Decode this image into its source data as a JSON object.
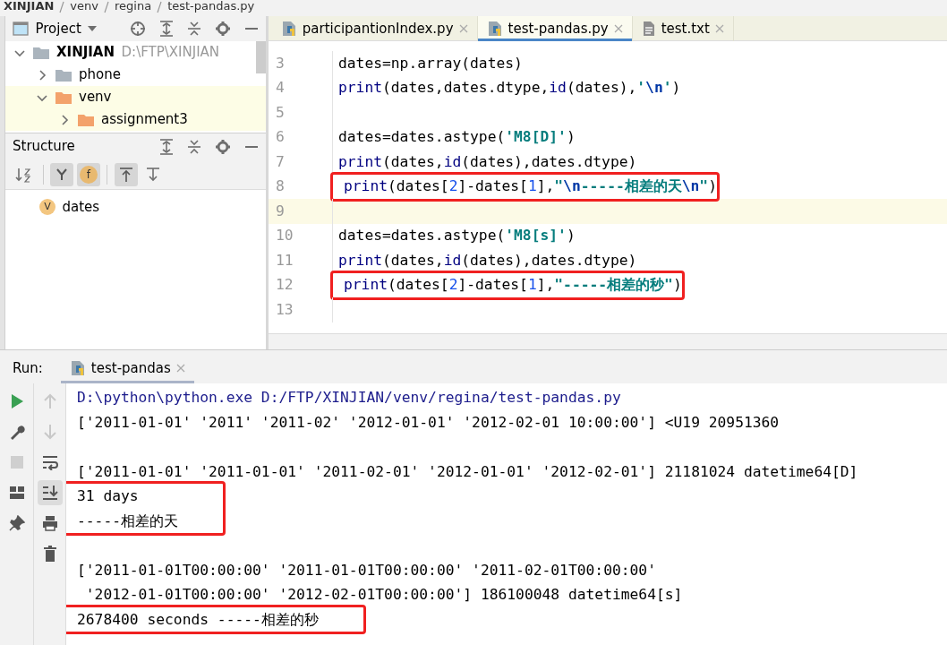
{
  "breadcrumb": [
    "XINJIAN",
    "venv",
    "regina",
    "test-pandas.py"
  ],
  "project_panel": {
    "title": "Project",
    "tree": [
      {
        "label": "XINJIAN",
        "path": "D:\\FTP\\XINJIAN",
        "expanded": true,
        "excluded": false,
        "children": [
          {
            "label": "phone",
            "expanded": false,
            "excluded": false
          },
          {
            "label": "venv",
            "expanded": true,
            "excluded": true,
            "children": [
              {
                "label": "assignment3",
                "expanded": false,
                "excluded": true
              }
            ]
          }
        ]
      }
    ]
  },
  "structure_panel": {
    "title": "Structure",
    "toggles": [
      {
        "on": false
      },
      {
        "on": true
      },
      {
        "label": "f",
        "on": true
      },
      {
        "on": true
      },
      {
        "on": false
      }
    ],
    "items": [
      {
        "badge": "V",
        "label": "dates"
      }
    ]
  },
  "editor": {
    "tabs": [
      {
        "label": "participantionIndex.py",
        "kind": "python",
        "selected": false
      },
      {
        "label": "test-pandas.py",
        "kind": "python",
        "selected": true
      },
      {
        "label": "test.txt",
        "kind": "text",
        "selected": false
      }
    ],
    "lines": [
      {
        "number": "3",
        "highlighted": false,
        "current": false,
        "tokens": [
          {
            "text": "dates=np.array(dates)",
            "kind": "plain"
          }
        ]
      },
      {
        "number": "4",
        "highlighted": false,
        "current": false,
        "tokens": [
          {
            "text": "print",
            "kind": "builtin"
          },
          {
            "text": "(dates,dates.dtype,",
            "kind": "plain"
          },
          {
            "text": "id",
            "kind": "builtin"
          },
          {
            "text": "(dates),",
            "kind": "plain"
          },
          {
            "text": "'",
            "kind": "string"
          },
          {
            "text": "\\n",
            "kind": "escape"
          },
          {
            "text": "'",
            "kind": "string"
          },
          {
            "text": ")",
            "kind": "plain"
          }
        ]
      },
      {
        "number": "5",
        "highlighted": false,
        "current": false
      },
      {
        "number": "6",
        "highlighted": false,
        "current": false,
        "tokens": [
          {
            "text": "dates=dates.astype(",
            "kind": "plain"
          },
          {
            "text": "'M8[D]'",
            "kind": "string"
          },
          {
            "text": ")",
            "kind": "plain"
          }
        ]
      },
      {
        "number": "7",
        "highlighted": false,
        "current": false,
        "tokens": [
          {
            "text": "print",
            "kind": "builtin"
          },
          {
            "text": "(dates,",
            "kind": "plain"
          },
          {
            "text": "id",
            "kind": "builtin"
          },
          {
            "text": "(dates),dates.dtype)",
            "kind": "plain"
          }
        ]
      },
      {
        "number": "8",
        "highlighted": true,
        "current": false,
        "tokens": [
          {
            "text": "print",
            "kind": "builtin"
          },
          {
            "text": "(dates[",
            "kind": "plain"
          },
          {
            "text": "2",
            "kind": "number"
          },
          {
            "text": "]-dates[",
            "kind": "plain"
          },
          {
            "text": "1",
            "kind": "number"
          },
          {
            "text": "],",
            "kind": "plain"
          },
          {
            "text": "\"",
            "kind": "string"
          },
          {
            "text": "\\n",
            "kind": "escape"
          },
          {
            "text": "-----相差的天",
            "kind": "string"
          },
          {
            "text": "\\n",
            "kind": "escape"
          },
          {
            "text": "\"",
            "kind": "string"
          },
          {
            "text": ")",
            "kind": "plain"
          }
        ]
      },
      {
        "number": "9",
        "highlighted": false,
        "current": true
      },
      {
        "number": "10",
        "highlighted": false,
        "current": false,
        "tokens": [
          {
            "text": "dates=dates.astype(",
            "kind": "plain"
          },
          {
            "text": "'M8[s]'",
            "kind": "string"
          },
          {
            "text": ")",
            "kind": "plain"
          }
        ]
      },
      {
        "number": "11",
        "highlighted": false,
        "current": false,
        "tokens": [
          {
            "text": "print",
            "kind": "builtin"
          },
          {
            "text": "(dates,",
            "kind": "plain"
          },
          {
            "text": "id",
            "kind": "builtin"
          },
          {
            "text": "(dates),dates.dtype)",
            "kind": "plain"
          }
        ]
      },
      {
        "number": "12",
        "highlighted": true,
        "current": false,
        "tokens": [
          {
            "text": "print",
            "kind": "builtin"
          },
          {
            "text": "(dates[",
            "kind": "plain"
          },
          {
            "text": "2",
            "kind": "number"
          },
          {
            "text": "]-dates[",
            "kind": "plain"
          },
          {
            "text": "1",
            "kind": "number"
          },
          {
            "text": "],",
            "kind": "plain"
          },
          {
            "text": "\"-----相差的秒\"",
            "kind": "string"
          },
          {
            "text": ")",
            "kind": "plain"
          }
        ]
      },
      {
        "number": "13",
        "highlighted": false,
        "current": false
      }
    ]
  },
  "run_panel": {
    "label": "Run:",
    "tab": "test-pandas",
    "left_tools": [
      {
        "disabled": false
      },
      {
        "disabled": false
      },
      {
        "disabled": true
      },
      {
        "disabled": false
      },
      {
        "disabled": false
      }
    ],
    "right_tools": [
      {
        "disabled": true,
        "on": false
      },
      {
        "disabled": true,
        "on": false
      },
      {
        "disabled": false,
        "on": false
      },
      {
        "disabled": false,
        "on": true
      },
      {
        "disabled": false,
        "on": false
      },
      {
        "disabled": false,
        "on": false
      }
    ],
    "console": [
      {
        "boxed": false,
        "blank_line_before": false,
        "lines": [
          {
            "text": "D:\\python\\python.exe D:/FTP/XINJIAN/venv/regina/test-pandas.py",
            "kind": "command"
          },
          {
            "text": "['2011-01-01' '2011' '2011-02' '2012-01-01' '2012-02-01 10:00:00'] <U19 20951360",
            "kind": "output"
          }
        ]
      },
      {
        "boxed": false,
        "blank_line_before": true,
        "lines": [
          {
            "text": "['2011-01-01' '2011-01-01' '2011-02-01' '2012-01-01' '2012-02-01'] 21181024 datetime64[D]",
            "kind": "output"
          }
        ]
      },
      {
        "boxed": true,
        "blank_line_before": false,
        "lines": [
          {
            "text": "31 days",
            "kind": "output"
          },
          {
            "text": "-----相差的天",
            "kind": "output"
          }
        ]
      },
      {
        "boxed": false,
        "blank_line_before": true,
        "lines": [
          {
            "text": "['2011-01-01T00:00:00' '2011-01-01T00:00:00' '2011-02-01T00:00:00'",
            "kind": "output"
          },
          {
            "text": " '2012-01-01T00:00:00' '2012-02-01T00:00:00'] 186100048 datetime64[s]",
            "kind": "output"
          }
        ]
      },
      {
        "boxed": true,
        "blank_line_before": false,
        "lines": [
          {
            "text": "2678400 seconds -----相差的秒",
            "kind": "output"
          }
        ]
      }
    ]
  }
}
